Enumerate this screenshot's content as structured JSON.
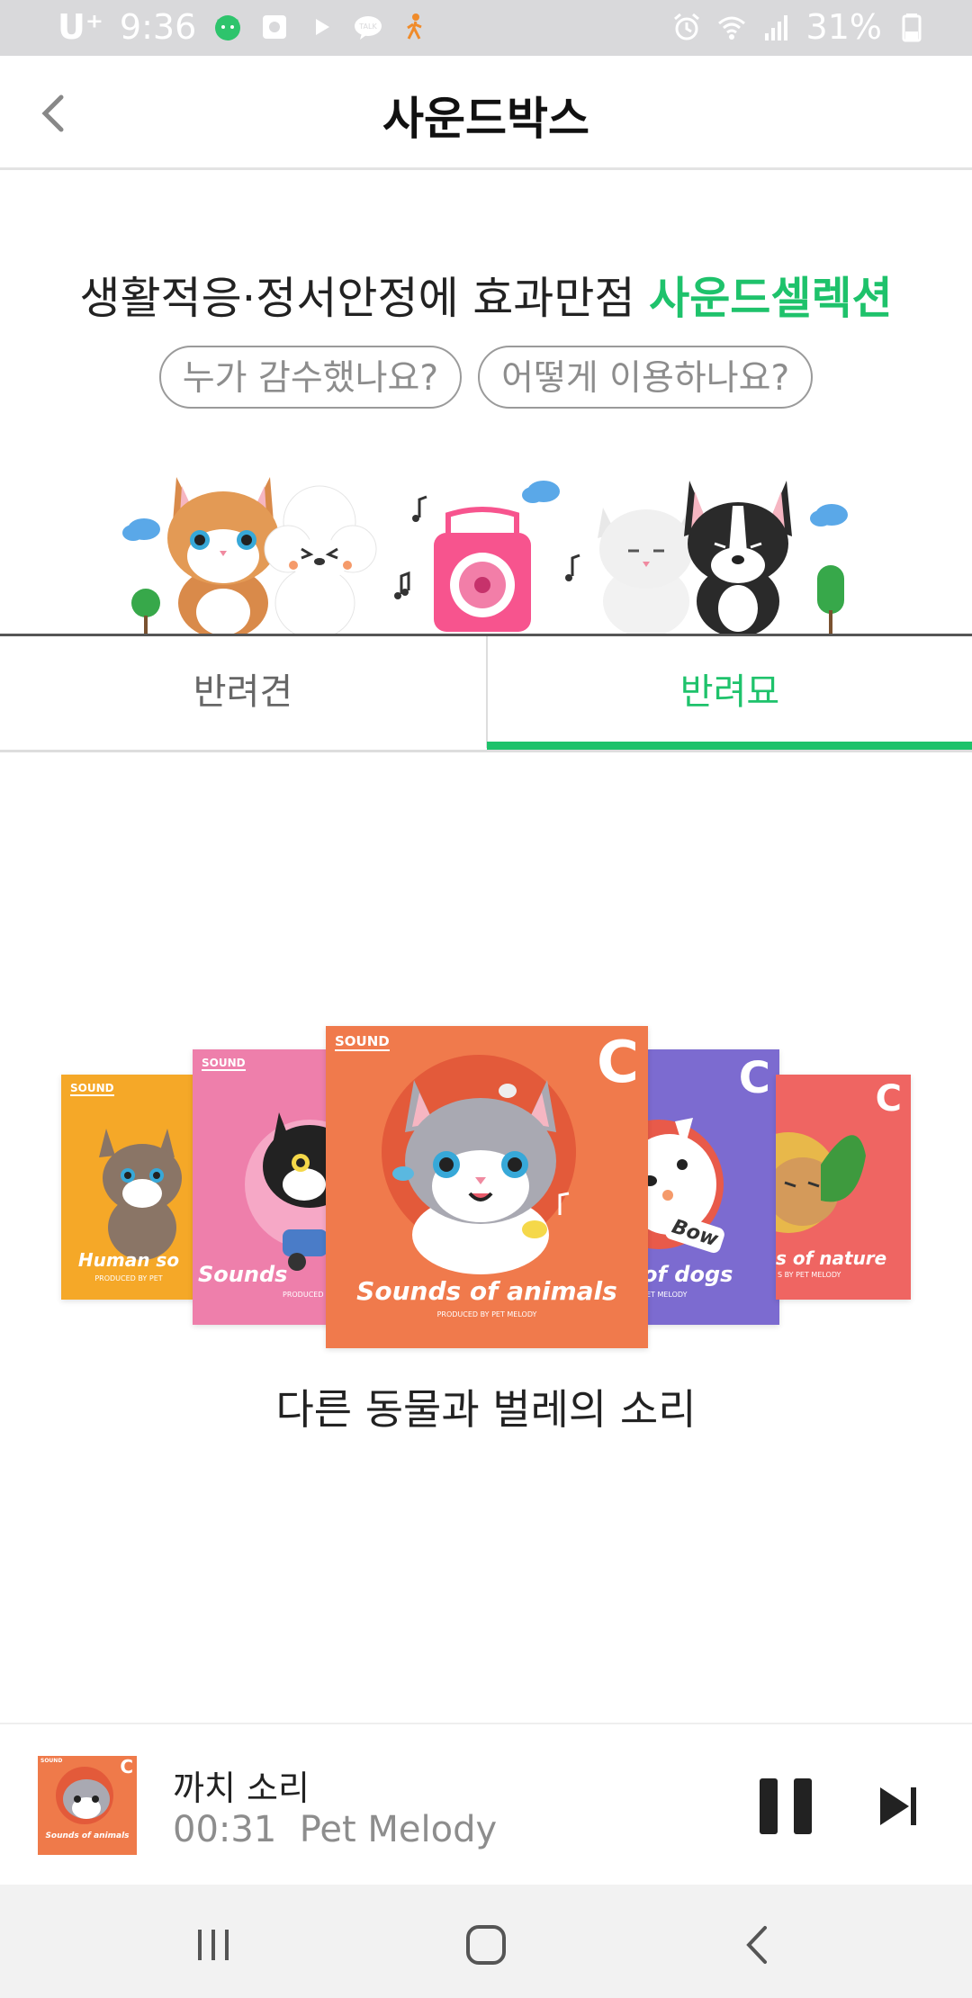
{
  "status": {
    "carrier": "U⁺",
    "time": "9:36",
    "battery": "31%",
    "left_icons": [
      "cat-app-icon",
      "gallery-icon",
      "play-icon",
      "kakaotalk-icon",
      "walking-icon"
    ],
    "right_icons": [
      "alarm-icon",
      "wifi-icon",
      "signal-icon",
      "battery-icon"
    ]
  },
  "appbar": {
    "title": "사운드박스",
    "back_icon": "chevron-left-icon"
  },
  "intro": {
    "headline_plain": "생활적응·정서안정에 효과만점 ",
    "headline_accent": "사운드셀렉션",
    "pill_1": "누가 감수했나요?",
    "pill_2": "어떻게 이용하나요?"
  },
  "tabs": {
    "dog": "반려견",
    "cat": "반려묘",
    "active": "반려묘"
  },
  "albums": [
    {
      "label": "SOUND",
      "caption": "Human so",
      "sub": "PRODUCED BY PET",
      "color": "#f5a828"
    },
    {
      "label": "SOUND",
      "caption": "Sounds",
      "sub": "PRODUCED B",
      "color": "#ee7fab"
    },
    {
      "label": "SOUND",
      "letter": "C",
      "caption": "Sounds of animals",
      "sub": "PRODUCED BY PET MELODY",
      "color": "#f07a4c"
    },
    {
      "letter": "C",
      "caption": "of dogs",
      "sub": "ET MELODY",
      "badge": "Bow",
      "color": "#7c6bd0"
    },
    {
      "letter": "C",
      "caption": "s of nature",
      "sub": "S BY PET MELODY",
      "color": "#ef6562"
    }
  ],
  "current_album_title": "다른 동물과 벌레의 소리",
  "player": {
    "track": "까치 소리",
    "elapsed": "00:31",
    "artist": "Pet Melody",
    "thumb_label": "SOUND",
    "thumb_letter": "C",
    "thumb_caption": "Sounds of animals",
    "state": "playing"
  },
  "colors": {
    "accent": "#1ec26b",
    "status_bar": "#d9d9db",
    "nav_bar": "#f2f2f2"
  },
  "navbar": [
    "recent-apps-icon",
    "home-icon",
    "back-icon"
  ]
}
